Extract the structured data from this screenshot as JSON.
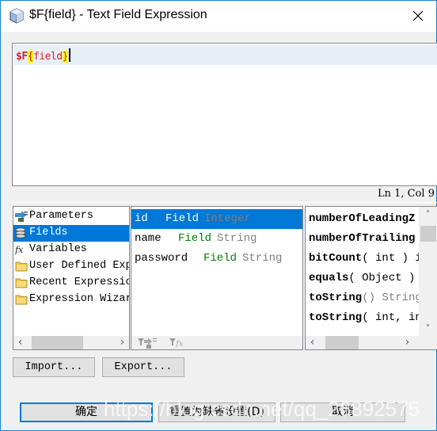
{
  "window": {
    "title": "$F{field} - Text Field Expression",
    "icon": "cube-icon",
    "close_icon": "close-icon"
  },
  "editor": {
    "tokens": {
      "prefix": "$F",
      "open_brace": "{",
      "name": "field",
      "close_brace": "}"
    },
    "status": "Ln 1, Col 9",
    "colors": {
      "text": "#e0202c",
      "bracket_highlight": "#ffff00",
      "current_line": "#e8eef7"
    }
  },
  "categories": {
    "selected_index": 1,
    "items": [
      {
        "label": "Parameters",
        "icon": "parameters-icon"
      },
      {
        "label": "Fields",
        "icon": "fields-icon"
      },
      {
        "label": "Variables",
        "icon": "fx-icon"
      },
      {
        "label": "User Defined Exp",
        "icon": "folder-icon"
      },
      {
        "label": "Recent Expressio",
        "icon": "folder-icon"
      },
      {
        "label": "Expression Wizar",
        "icon": "folder-icon"
      }
    ]
  },
  "fields": {
    "selected_index": 0,
    "rows": [
      {
        "name": "id",
        "kind": "Field",
        "type": "Integer"
      },
      {
        "name": "name",
        "kind": "Field",
        "type": "String"
      },
      {
        "name": "password",
        "kind": "Field",
        "type": "String"
      }
    ],
    "toolbar": [
      "filter-parameters-icon",
      "filter-fx-icon"
    ]
  },
  "methods": {
    "rows": [
      {
        "name": "numberOfLeadingZ",
        "args": ""
      },
      {
        "name": "numberOfTrailing",
        "args": ""
      },
      {
        "name": "bitCount",
        "args": "( int ) i"
      },
      {
        "name": "equals",
        "args": "( Object ) "
      },
      {
        "name": "toString",
        "args": "() String"
      },
      {
        "name": "toString",
        "args": "( int, in"
      }
    ]
  },
  "buttons": {
    "import": "Import...",
    "export": "Export...",
    "ok": "确定",
    "reset": "重置为缺省设置(D)",
    "cancel": "取消"
  },
  "watermark": "https://blog.csdn.net/qq_26892575",
  "colors": {
    "accent": "#0078d7",
    "field_kind": "#008000",
    "type": "#808080"
  }
}
